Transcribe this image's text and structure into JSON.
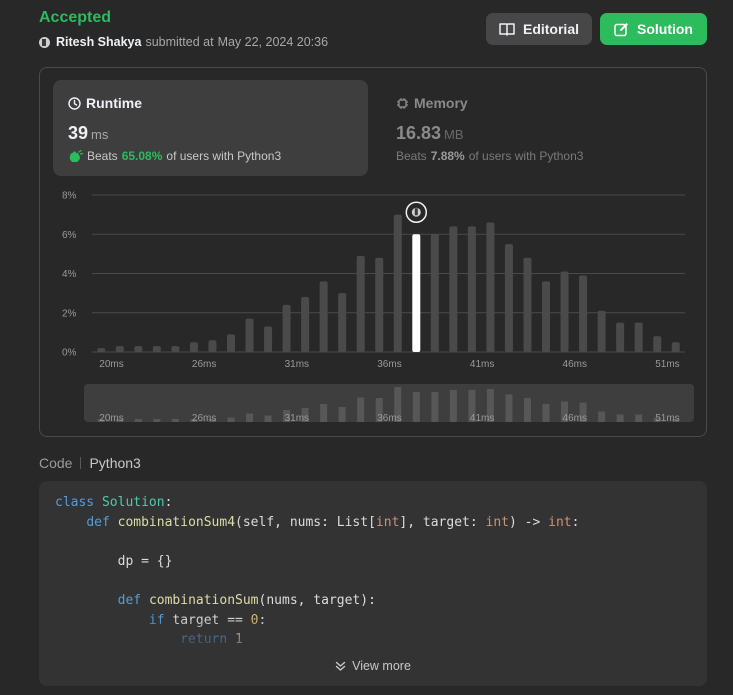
{
  "header": {
    "status": "Accepted",
    "user": "Ritesh Shakya",
    "submitted_label": "submitted at",
    "timestamp": "May 22, 2024 20:36",
    "editorial_label": "Editorial",
    "solution_label": "Solution",
    "accent": "#2cbb5d"
  },
  "runtime": {
    "title": "Runtime",
    "value": "39",
    "unit": "ms",
    "beats_label": "Beats",
    "beats_pct": "65.08%",
    "beats_suffix": "of users with Python3"
  },
  "memory": {
    "title": "Memory",
    "value": "16.83",
    "unit": "MB",
    "beats_label": "Beats",
    "beats_pct": "7.88%",
    "beats_suffix": "of users with Python3"
  },
  "chart_data": {
    "type": "bar",
    "ylim": [
      0,
      8
    ],
    "y_ticks": [
      "8%",
      "6%",
      "4%",
      "2%",
      "0%"
    ],
    "x_tick_labels": [
      "20ms",
      "26ms",
      "31ms",
      "36ms",
      "41ms",
      "46ms",
      "51ms"
    ],
    "values": [
      0.2,
      0.3,
      0.3,
      0.3,
      0.3,
      0.5,
      0.6,
      0.9,
      1.7,
      1.3,
      2.4,
      2.8,
      3.6,
      3.0,
      4.9,
      4.8,
      7.0,
      6.0,
      6.0,
      6.4,
      6.4,
      6.6,
      5.5,
      4.8,
      3.6,
      4.1,
      3.9,
      2.1,
      1.5,
      1.5,
      0.8,
      0.5
    ],
    "highlight_index": 17,
    "highlight_label": "39ms",
    "grid": true
  },
  "code_section": {
    "label": "Code",
    "language": "Python3",
    "view_more": "View more"
  },
  "colors": {
    "background": "#282828",
    "card": "#3e3e3e",
    "bar": "#4a4a4a",
    "bar_highlight": "#ffffff"
  }
}
